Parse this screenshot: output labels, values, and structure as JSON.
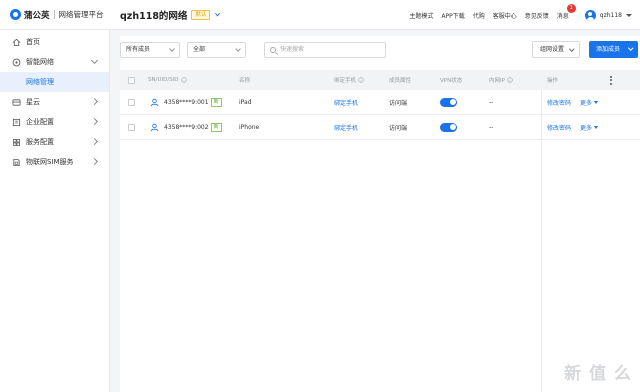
{
  "header": {
    "brand": "蒲公英",
    "subtitle": "网络管理平台",
    "network_title": "qzh118的网络",
    "default_badge": "默认",
    "nav": [
      "主题模式",
      "APP下载",
      "代购",
      "客服中心",
      "意见反馈"
    ],
    "messages_label": "消息",
    "messages_count": "1",
    "username": "qzh118"
  },
  "sidebar": {
    "items": [
      {
        "label": "首页",
        "icon": "home-icon"
      },
      {
        "label": "智能网络",
        "icon": "network-icon",
        "expanded": true
      },
      {
        "label": "网络管理",
        "sub": true,
        "active": true
      },
      {
        "label": "星云",
        "icon": "cloud-icon"
      },
      {
        "label": "企业配置",
        "icon": "enterprise-icon"
      },
      {
        "label": "服务配置",
        "icon": "service-icon"
      },
      {
        "label": "物联网SIM服务",
        "icon": "sim-icon"
      }
    ]
  },
  "toolbar": {
    "member_filter": "所有成员",
    "status_filter": "全部",
    "search_placeholder": "快速搜索",
    "group_settings": "组网设置",
    "add_member": "添加成员"
  },
  "table": {
    "columns": [
      "SN/UID/SID",
      "名称",
      "绑定手机",
      "成员属性",
      "VPN状态",
      "内网IP",
      "操作"
    ],
    "rows": [
      {
        "id": "4358****9:001",
        "badge": "新",
        "name": "iPad",
        "phone": "绑定手机",
        "attr": "访问端",
        "vpn": true,
        "ip": "--",
        "action1": "修改密码",
        "action2": "更多"
      },
      {
        "id": "4358****9:002",
        "badge": "新",
        "name": "iPhone",
        "phone": "绑定手机",
        "attr": "访问端",
        "vpn": true,
        "ip": "--",
        "action1": "修改密码",
        "action2": "更多"
      }
    ]
  },
  "watermark": "新 值 么",
  "colors": {
    "accent": "#1a73e8",
    "badge_red": "#e53935",
    "new_green": "#52a829"
  }
}
